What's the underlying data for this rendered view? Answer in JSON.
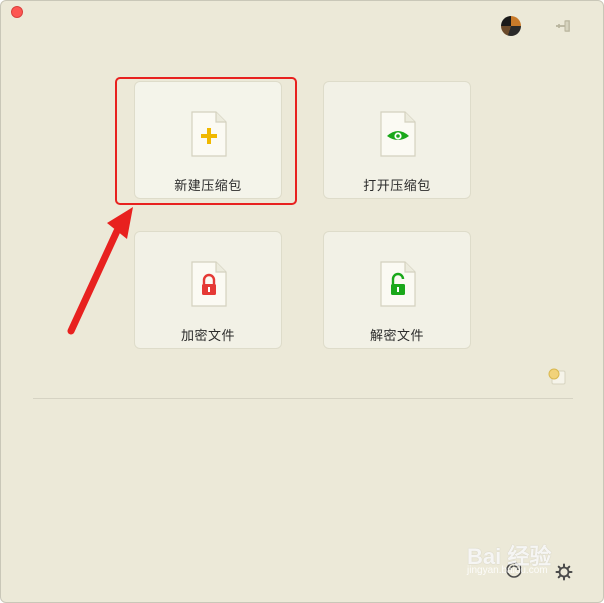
{
  "tiles": {
    "new": {
      "label": "新建压缩包",
      "icon": "plus-document-icon",
      "color": "#f0b800"
    },
    "open": {
      "label": "打开压缩包",
      "icon": "eye-document-icon",
      "color": "#1aa81a"
    },
    "encrypt": {
      "label": "加密文件",
      "icon": "locked-document-icon",
      "color": "#e53935"
    },
    "decrypt": {
      "label": "解密文件",
      "icon": "unlocked-document-icon",
      "color": "#1aa81a"
    }
  },
  "annotation": {
    "color": "#e8211f"
  },
  "watermark": {
    "text": "Bai 经验",
    "url": "jingyan.baidu.com"
  }
}
